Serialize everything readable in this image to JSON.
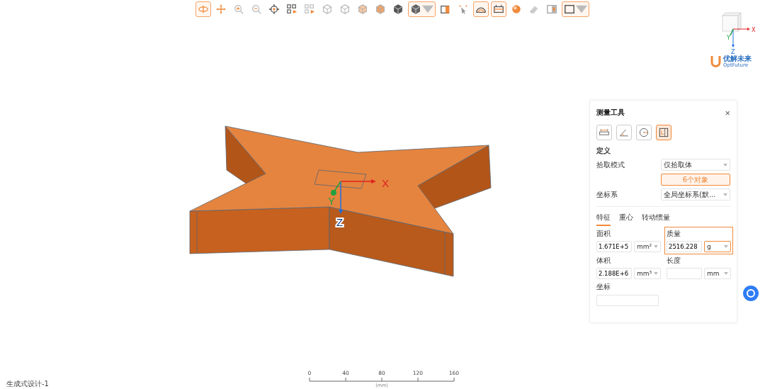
{
  "toolbar": [
    {
      "kind": "button",
      "selected": true
    },
    {
      "kind": "button",
      "selected": false
    },
    {
      "kind": "button",
      "selected": false
    },
    {
      "kind": "button",
      "selected": false
    },
    {
      "kind": "button",
      "selected": false
    },
    {
      "kind": "button",
      "selected": false
    },
    {
      "kind": "button",
      "selected": false
    },
    {
      "kind": "button",
      "selected": false
    },
    {
      "kind": "button",
      "selected": false
    },
    {
      "kind": "button",
      "selected": false
    },
    {
      "kind": "button",
      "selected": false
    },
    {
      "kind": "button",
      "selected": false
    },
    {
      "kind": "dropdown",
      "selected": true
    },
    {
      "kind": "button",
      "selected": false
    },
    {
      "kind": "button",
      "selected": false
    },
    {
      "kind": "button",
      "selected": true
    },
    {
      "kind": "button",
      "selected": true
    },
    {
      "kind": "button",
      "selected": false
    },
    {
      "kind": "button",
      "selected": false
    },
    {
      "kind": "button",
      "selected": false
    },
    {
      "kind": "dropdown",
      "selected": true
    }
  ],
  "view_cube": {
    "axis_labels": [
      "X",
      "Y",
      "Z"
    ]
  },
  "logo": {
    "name": "优解未来",
    "tagline": "OptFuture"
  },
  "viewport": {
    "axis_labels": [
      "X",
      "Y",
      "Z"
    ]
  },
  "panel": {
    "title": "测量工具",
    "close": "×",
    "tools": [
      {
        "selected": false
      },
      {
        "selected": false
      },
      {
        "selected": false
      },
      {
        "selected": true
      }
    ],
    "section": "定义",
    "pick_mode": {
      "label": "拾取模式",
      "value": "仅拾取体"
    },
    "objects_button": "6个对象",
    "coord_system": {
      "label": "坐标系",
      "value": "全局坐标系(默..."
    },
    "tabs": [
      {
        "label": "特征",
        "selected": true
      },
      {
        "label": "重心",
        "selected": false
      },
      {
        "label": "转动惯量",
        "selected": false
      }
    ],
    "fields": [
      {
        "label": "面积",
        "value": "1.671E+5",
        "unit": "mm²",
        "highlighted": false
      },
      {
        "label": "质量",
        "value": "2516.228",
        "unit": "g",
        "highlighted": true
      },
      {
        "label": "体积",
        "value": "2.188E+6",
        "unit": "mm³",
        "highlighted": false
      },
      {
        "label": "长度",
        "unit": "mm",
        "highlighted": false
      }
    ],
    "coord_field": {
      "label": "坐标"
    }
  },
  "scale_bar": {
    "ticks": [
      "0",
      "40",
      "80",
      "120",
      "160"
    ],
    "unit": "(mm)"
  },
  "document_name": "生成式设计-1"
}
